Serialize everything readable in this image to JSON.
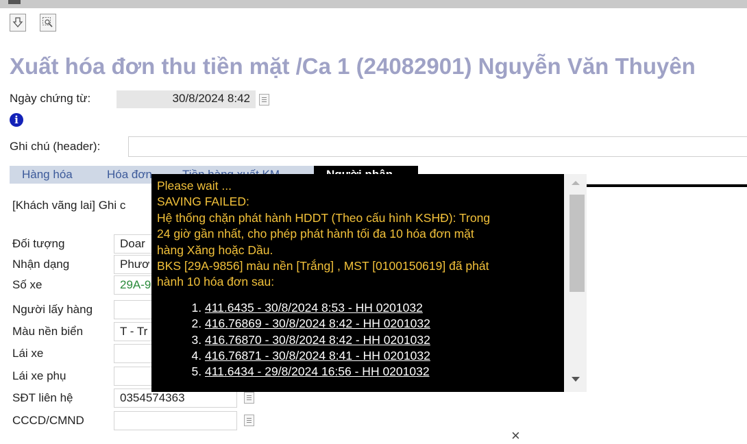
{
  "toolbar": {
    "icons": [
      "download-icon",
      "zoom-select-icon"
    ]
  },
  "page": {
    "title": "Xuất hóa đơn thu tiền mặt /Ca 1 (24082901) Nguyễn Văn Thuyên"
  },
  "header": {
    "date_label": "Ngày chứng từ:",
    "date_value": "30/8/2024 8:42",
    "note_label": "Ghi chú (header):",
    "note_value": ""
  },
  "tabs": [
    {
      "label": "Hàng hóa"
    },
    {
      "label": "Hóa đơn"
    },
    {
      "label": "Tiền hàng xuất KM"
    },
    {
      "label": "Người nhận"
    }
  ],
  "customer": {
    "line": "[Khách vãng lai] Ghi c"
  },
  "fields": [
    {
      "label": "Đối tượng",
      "value": "Doar"
    },
    {
      "label": "Nhận dạng",
      "value": "Phươ"
    },
    {
      "label": "Số xe",
      "value": "29A-9"
    },
    {
      "label": "Người lấy hàng",
      "value": ""
    },
    {
      "label": "Màu nền biển",
      "value": "T - Tr"
    },
    {
      "label": "Lái xe",
      "value": ""
    },
    {
      "label": "Lái xe phụ",
      "value": ""
    },
    {
      "label": "SĐT liên hệ",
      "value": "0354574363"
    },
    {
      "label": "CCCD/CMND",
      "value": ""
    }
  ],
  "popup": {
    "lines": [
      "Please wait ...",
      "SAVING FAILED:",
      "Hệ thống chặn phát hành HDDT (Theo cấu hình KSHĐ): Trong",
      "24 giờ gần nhất, cho phép phát hành tối đa 10 hóa đơn mặt",
      "hàng Xăng hoặc Dầu.",
      "BKS [29A-9856] màu nền [Trắng] , MST [0100150619] đã phát",
      "hành 10 hóa đơn sau:"
    ],
    "invoices": [
      "411.6435 - 30/8/2024 8:53 - HH 0201032",
      "416.76869 - 30/8/2024 8:42 - HH 0201032",
      "416.76870 - 30/8/2024 8:42 - HH 0201032",
      "416.76871 - 30/8/2024 8:41 - HH 0201032",
      "411.6434 - 29/8/2024 16:56 - HH 0201032"
    ],
    "text_color": "#f2c13a",
    "background": "#000000"
  },
  "close_label": "×"
}
